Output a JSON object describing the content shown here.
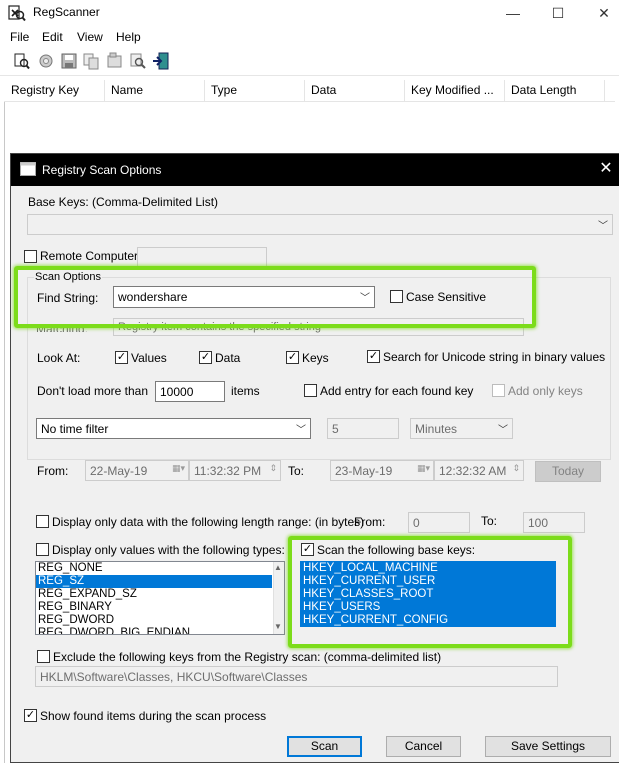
{
  "window": {
    "title": "RegScanner",
    "minimize": "—",
    "maximize": "☐",
    "close": "✕"
  },
  "menu": [
    "File",
    "Edit",
    "View",
    "Help"
  ],
  "toolbar_icons": [
    "save-icon",
    "copy-icon",
    "save-disk-icon",
    "copy-items-icon",
    "properties-icon",
    "find-icon",
    "exit-icon"
  ],
  "columns": [
    "Registry Key",
    "Name",
    "Type",
    "Data",
    "Key Modified ...",
    "Data Length"
  ],
  "dialog": {
    "title": "Registry Scan Options",
    "close": "✕",
    "base_keys_label": "Base Keys:  (Comma-Delimited List)",
    "base_keys_value": "",
    "remote_computer_label": "Remote Computer:",
    "remote_computer_value": "",
    "scan_options_label": "Scan Options",
    "find_string_label": "Find String:",
    "find_string_value": "wondershare",
    "case_sensitive_label": "Case Sensitive",
    "match_label": "Matching:",
    "match_value": "Registry item contains the specified string",
    "look_at_label": "Look At:",
    "look_values": "Values",
    "look_data": "Data",
    "look_keys": "Keys",
    "unicode_label": "Search for Unicode string in binary values",
    "dont_load_label": "Don't load more than",
    "dont_load_value": "10000",
    "items_label": "items",
    "add_entry_label": "Add entry for each found key",
    "add_only_keys_label": "Add only keys",
    "time_filter_value": "No time filter",
    "time_amount": "5",
    "time_unit": "Minutes",
    "from_label": "From:",
    "from_date": "22-May-19",
    "from_time": "11:32:32 PM",
    "to_label": "To:",
    "to_date": "23-May-19",
    "to_time": "12:32:32 AM",
    "today_label": "Today",
    "length_range_label": "Display only data with the following length range: (in bytes)",
    "length_from_label": "From:",
    "length_from_value": "0",
    "length_to_label": "To:",
    "length_to_value": "100",
    "types_label": "Display only values with the following types:",
    "types": [
      "REG_NONE",
      "REG_SZ",
      "REG_EXPAND_SZ",
      "REG_BINARY",
      "REG_DWORD",
      "REG_DWORD_BIG_ENDIAN"
    ],
    "scan_base_keys_label": "Scan the following base keys:",
    "base_keys_list": [
      "HKEY_LOCAL_MACHINE",
      "HKEY_CURRENT_USER",
      "HKEY_CLASSES_ROOT",
      "HKEY_USERS",
      "HKEY_CURRENT_CONFIG"
    ],
    "exclude_label": "Exclude the following keys from the Registry scan: (comma-delimited list)",
    "exclude_value": "HKLM\\Software\\Classes, HKCU\\Software\\Classes",
    "show_found_label": "Show found items during the scan process",
    "scan_button": "Scan",
    "cancel_button": "Cancel",
    "save_settings_button": "Save Settings"
  },
  "colors": {
    "highlight": "#7cdc1a",
    "selection": "#0078d7",
    "dialog_bg": "#f0f0f0",
    "title_bar": "#000000"
  }
}
